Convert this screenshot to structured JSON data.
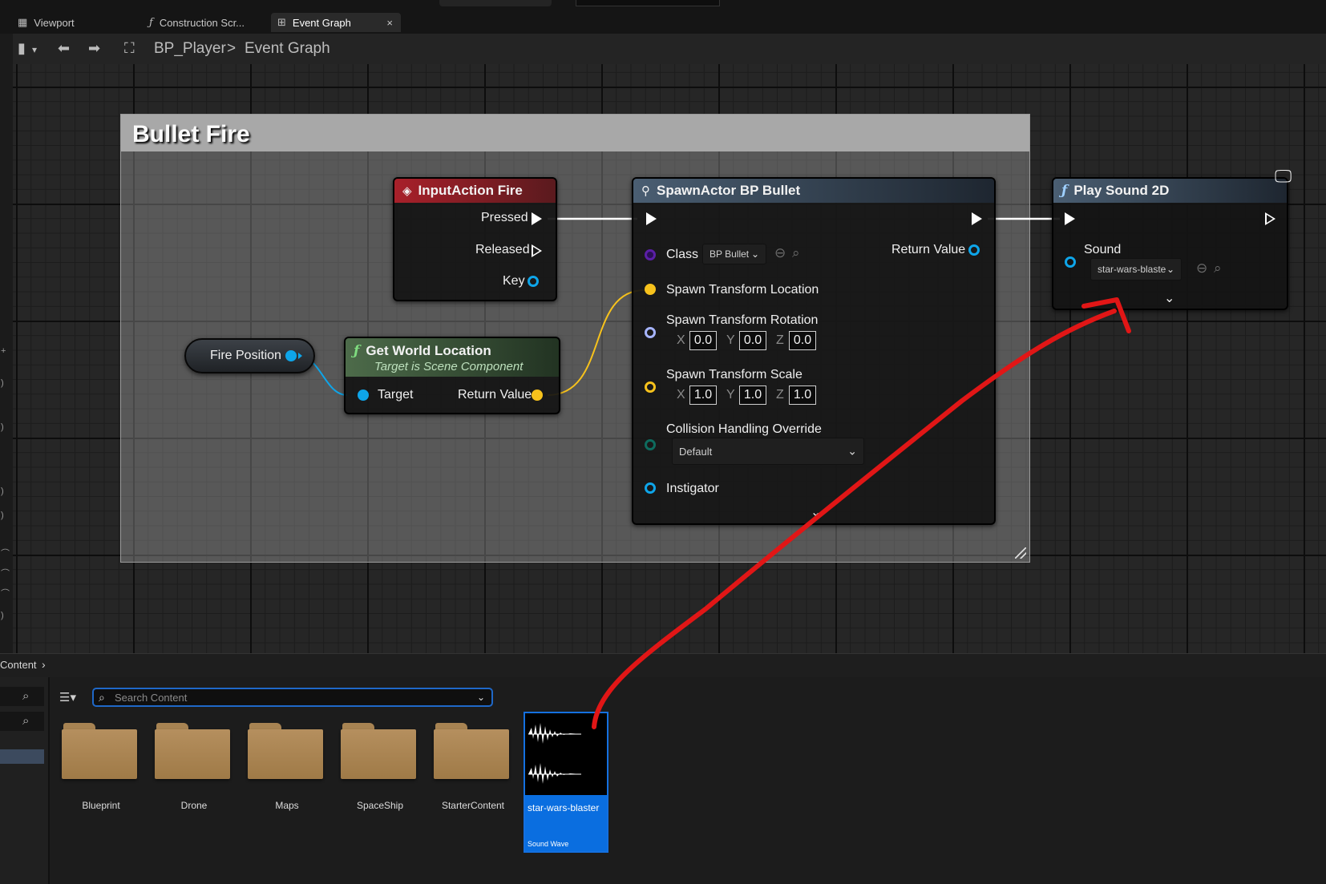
{
  "tabs": [
    {
      "label": "Viewport",
      "icon": "grid-icon"
    },
    {
      "label": "Construction Scr...",
      "icon": "function-icon"
    },
    {
      "label": "Event Graph",
      "icon": "graph-icon",
      "active": true
    }
  ],
  "tab_close": "×",
  "breadcrumb": {
    "root": "BP_Player",
    "separator": ">",
    "current": "Event Graph"
  },
  "comment": {
    "title": "Bullet Fire"
  },
  "nodes": {
    "input_action": {
      "title": "InputAction Fire",
      "pins": {
        "pressed": "Pressed",
        "released": "Released",
        "key": "Key"
      }
    },
    "fire_position": {
      "label": "Fire Position"
    },
    "get_world_location": {
      "title": "Get World Location",
      "subtitle": "Target is Scene Component",
      "target": "Target",
      "return_value": "Return Value"
    },
    "spawn_actor": {
      "title": "SpawnActor BP Bullet",
      "class_label": "Class",
      "class_value": "BP Bullet",
      "return_value": "Return Value",
      "location": "Spawn Transform Location",
      "rotation": {
        "label": "Spawn Transform Rotation",
        "x": "0.0",
        "y": "0.0",
        "z": "0.0"
      },
      "scale": {
        "label": "Spawn Transform Scale",
        "x": "1.0",
        "y": "1.0",
        "z": "1.0"
      },
      "axis_x": "X",
      "axis_y": "Y",
      "axis_z": "Z",
      "collision": {
        "label": "Collision Handling Override",
        "value": "Default"
      },
      "instigator": "Instigator"
    },
    "play_sound": {
      "title": "Play Sound 2D",
      "sound_label": "Sound",
      "sound_value": "star-wars-blaste"
    }
  },
  "content_browser": {
    "breadcrumb": "Content",
    "search_placeholder": "Search Content",
    "folders": [
      "Blueprint",
      "Drone",
      "Maps",
      "SpaceShip",
      "StarterContent"
    ],
    "asset": {
      "name": "star-wars-blaster",
      "type": "Sound Wave"
    }
  },
  "colors": {
    "exec": "#ffffff",
    "object_pin": "#0ea5e9",
    "vector_pin": "#f7c21c",
    "rotator_pin": "#a6b4ff",
    "class_pin": "#5b1fa6",
    "enum_pin": "#0e6b5e",
    "annotation": "#e11616",
    "selection": "#0a6ee0"
  }
}
